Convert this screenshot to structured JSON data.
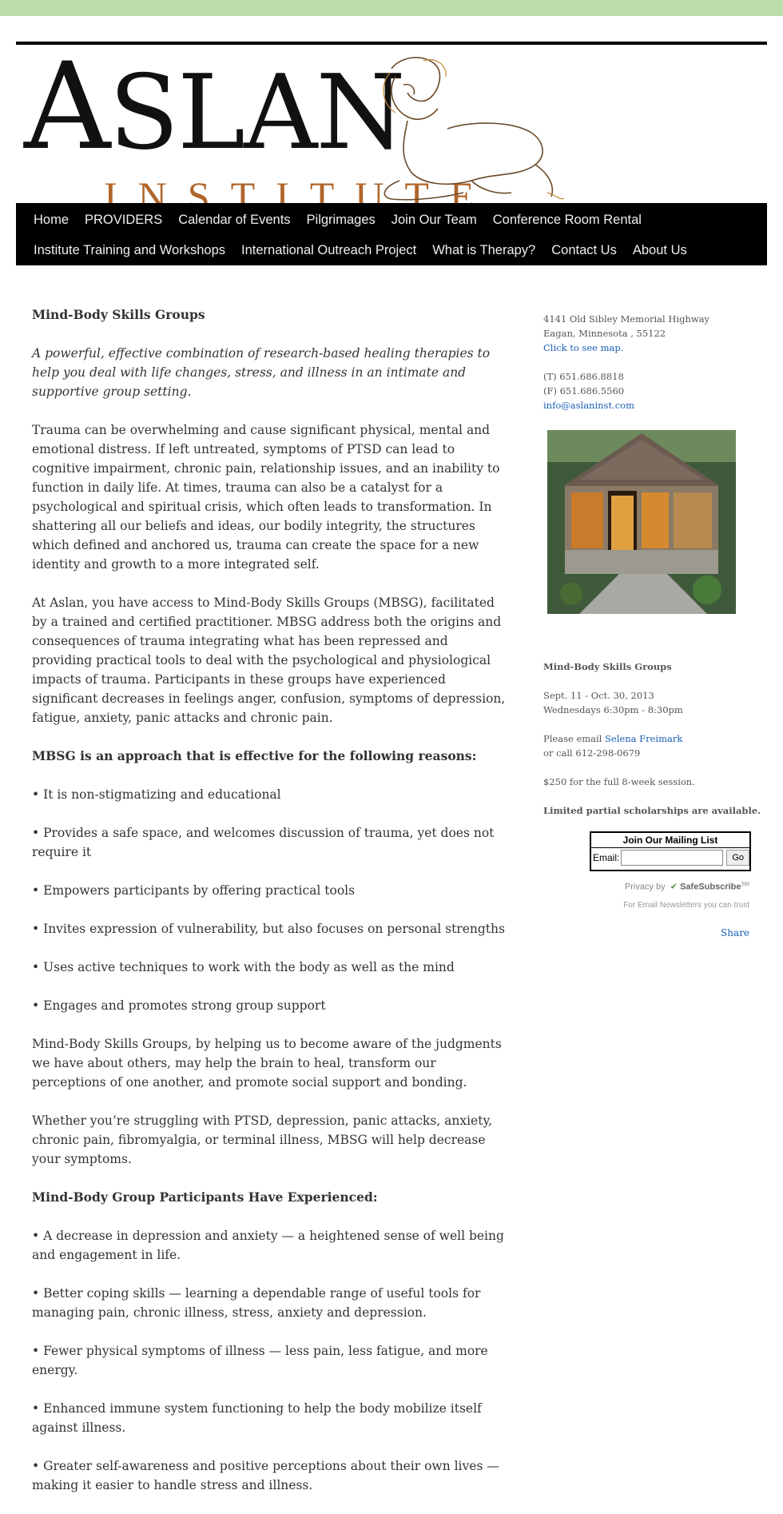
{
  "logo": {
    "word_big": "A",
    "word_rest": "SLAN",
    "sub": "INSTITUTE"
  },
  "nav": {
    "row1": [
      "Home",
      "PROVIDERS",
      "Calendar of Events",
      "Pilgrimages",
      "Join Our Team",
      "Conference Room Rental"
    ],
    "row2": [
      "Institute Training and Workshops",
      "International Outreach Project",
      "What is Therapy?",
      "Contact Us",
      "About Us"
    ]
  },
  "main": {
    "title": "Mind-Body Skills Groups",
    "intro": "A powerful, effective combination of research-based healing therapies to help you deal with life changes, stress, and illness in an intimate and supportive group setting.",
    "p1": "Trauma can be overwhelming and cause significant physical, mental and emotional distress. If left untreated, symptoms of PTSD can lead to cognitive impairment, chronic pain, relationship issues, and an inability to function in daily life. At times, trauma can also be a catalyst for a psychological and spiritual crisis, which often leads to transformation. In shattering all our beliefs and ideas, our bodily integrity, the structures which defined and anchored us, trauma can create the space for a new identity and growth to a more integrated self.",
    "p2": "At Aslan, you have access to Mind-Body Skills Groups (MBSG), facilitated by a trained and certified practitioner. MBSG address both the origins and consequences of trauma integrating what has been repressed and providing practical tools to deal with the psychological and physiological impacts of trauma. Participants in these groups have experienced significant decreases in feelings anger, confusion, symptoms of depression, fatigue, anxiety, panic attacks and chronic pain.",
    "reasons_heading": "MBSG is an approach that is effective for the following reasons:",
    "reasons": [
      "• It is non-stigmatizing and educational",
      "• Provides a safe space, and welcomes discussion of trauma, yet does not require it",
      "• Empowers participants by offering practical tools",
      "• Invites expression of vulnerability, but also focuses on personal strengths",
      "• Uses active techniques to work with the body as well as the mind",
      "• Engages and promotes strong group support"
    ],
    "p3": "Mind-Body Skills Groups, by helping us to become aware of the judgments we have about others, may help the brain to heal, transform our perceptions of one another, and promote social support and bonding.",
    "p4": "Whether you’re struggling with PTSD, depression, panic attacks, anxiety, chronic pain, fibromyalgia, or terminal illness, MBSG will help decrease your symptoms.",
    "exp_heading": "Mind-Body Group Participants Have Experienced:",
    "experiences": [
      "• A decrease in depression and anxiety — a heightened sense of well being and engagement in life.",
      "• Better coping skills — learning a dependable range of useful tools for managing pain, chronic illness, stress, anxiety and depression.",
      "• Fewer physical symptoms of illness — less pain, less fatigue, and more energy.",
      "• Enhanced immune system functioning to help the body mobilize itself against illness.",
      "• Greater self-awareness and positive perceptions about their own lives — making it easier to handle stress and illness."
    ]
  },
  "sidebar": {
    "address1": "4141 Old Sibley Memorial Highway",
    "address2": "Eagan, Minnesota , 55122",
    "map_link": "Click to see map.",
    "phone": "(T) 651.686.8818",
    "fax": "(F) 651.686.5560",
    "email": "info@aslaninst.com",
    "group_title": "Mind-Body Skills Groups",
    "dates": "Sept. 11 - Oct. 30, 2013",
    "times": "Wednesdays 6:30pm - 8:30pm",
    "contact_prefix": "Please email ",
    "contact_name": "Selena Freimark",
    "contact_call": "or call 612-298-0679",
    "price": "$250 for the full 8-week session.",
    "scholarships": "Limited partial scholarships are available.",
    "mailing_title": "Join Our Mailing List",
    "email_label": "Email:",
    "email_value": "",
    "go_label": "Go",
    "privacy_by": "Privacy by",
    "safesubscribe": "SafeSubscribe",
    "sm": "SM",
    "tagline": "For Email Newsletters you can trust",
    "share": "Share"
  },
  "colors": {
    "topbar": "#bcdead",
    "nav_bg": "#000000",
    "link": "#1a5fb4",
    "logo_sub": "#b0652a"
  }
}
